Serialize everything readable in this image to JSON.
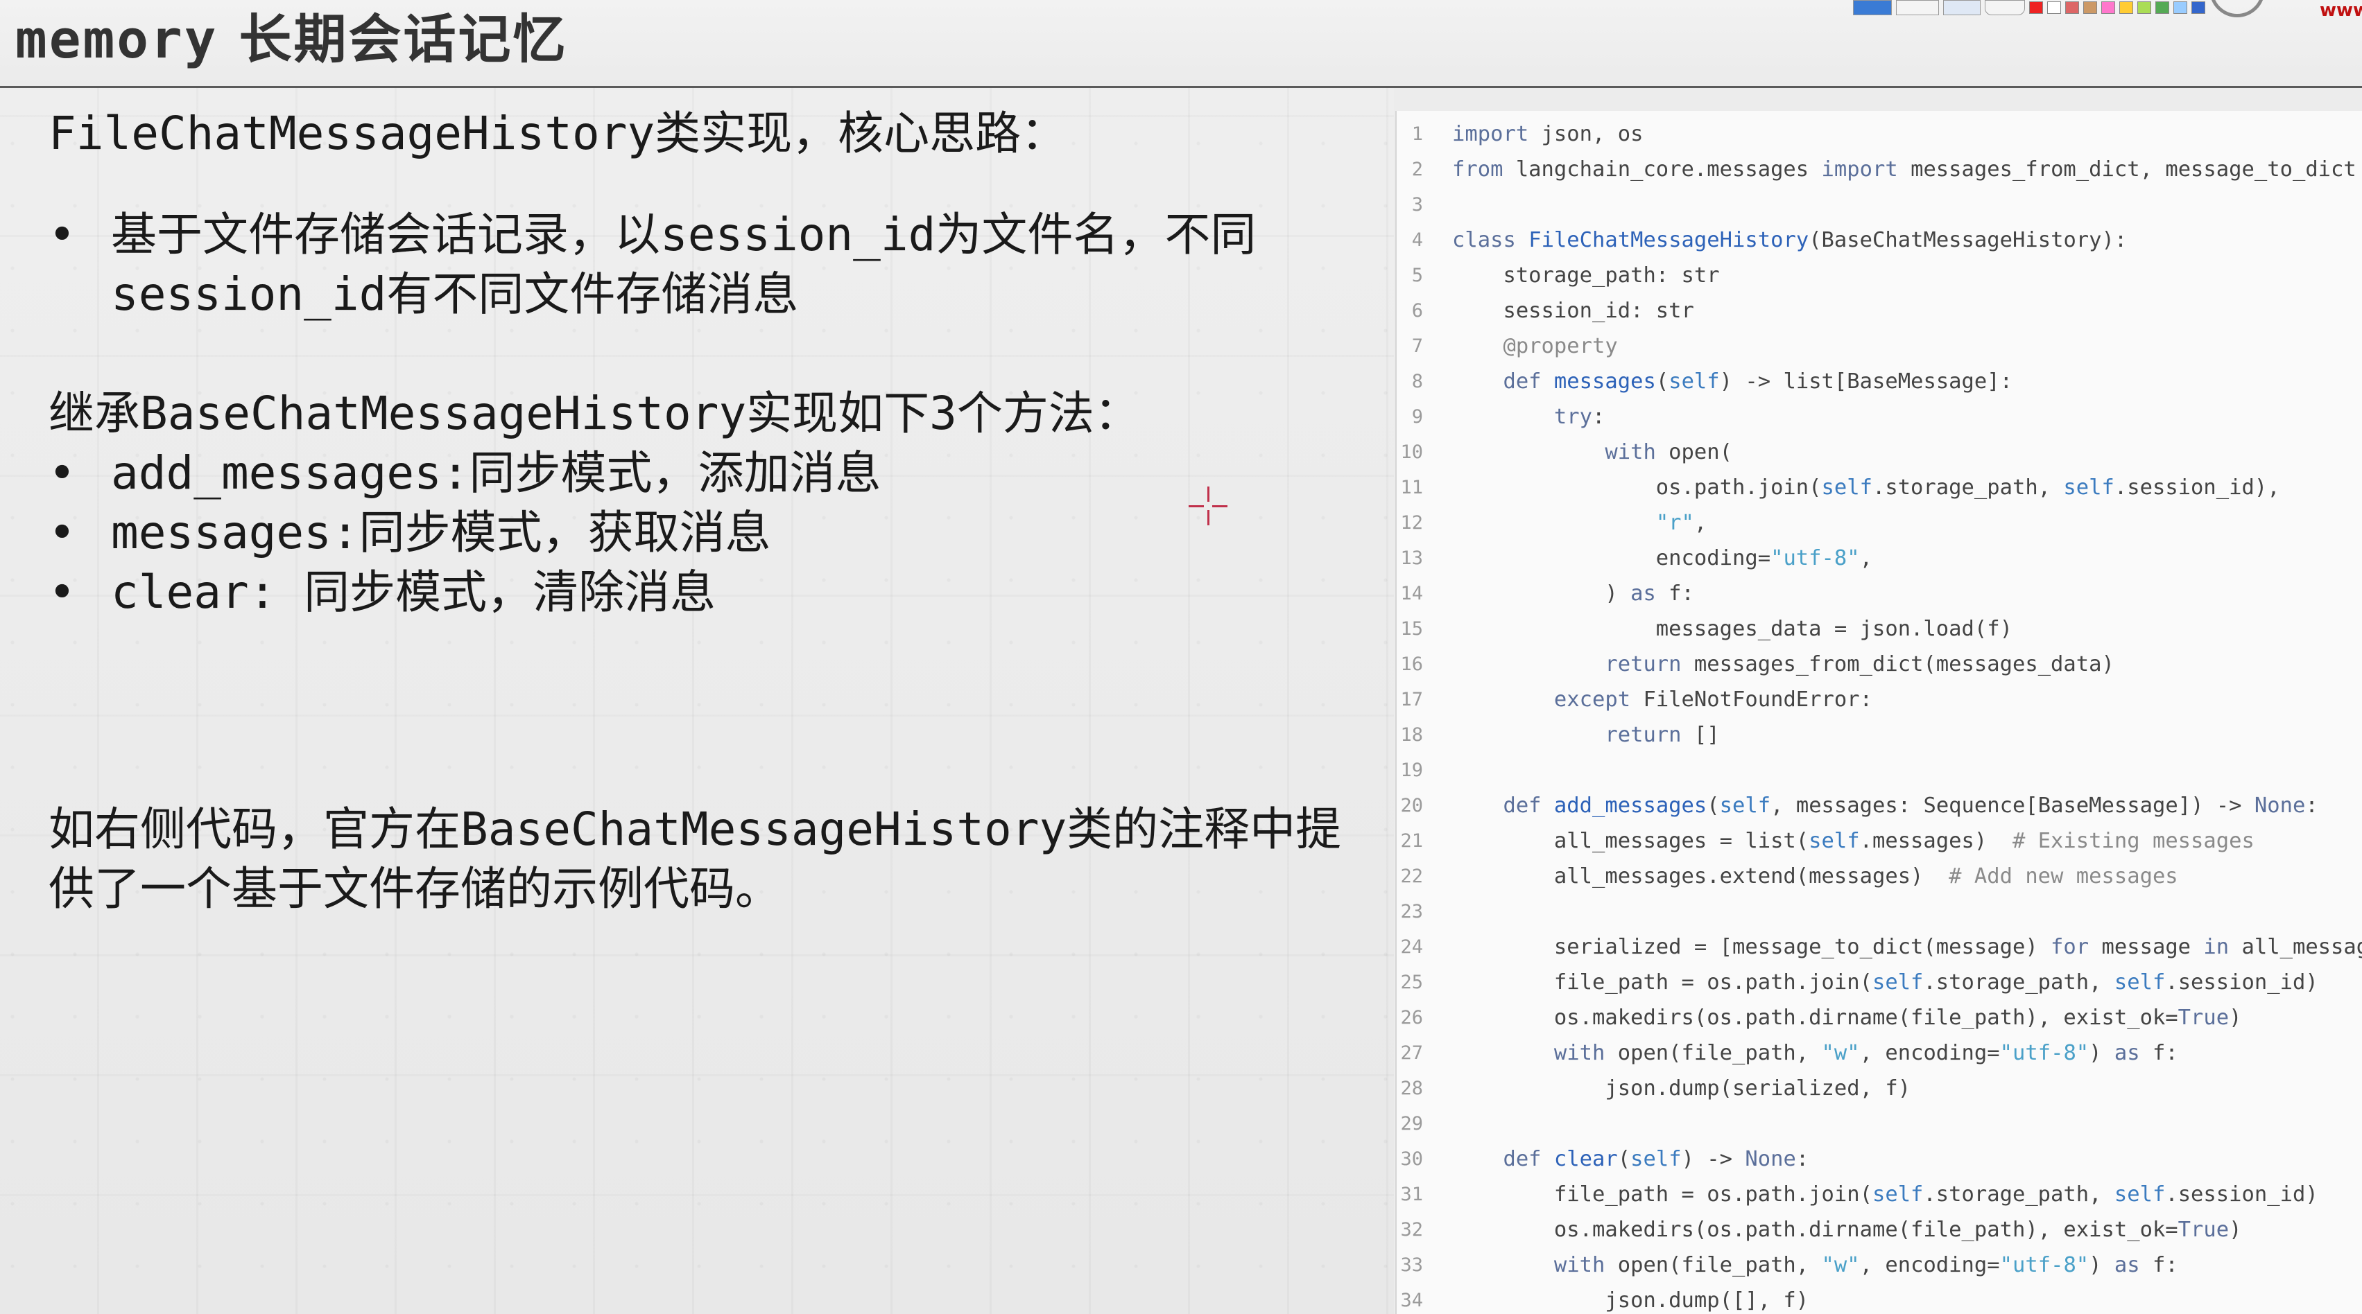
{
  "header": {
    "title_en": "memory",
    "title_cn": "长期会话记忆",
    "corner_text": "www"
  },
  "left": {
    "intro": "FileChatMessageHistory类实现，核心思路：",
    "bullets_a": [
      "基于文件存储会话记录，以session_id为文件名，不同session_id有不同文件存储消息"
    ],
    "inherit_heading": "继承BaseChatMessageHistory实现如下3个方法：",
    "bullets_b": [
      "add_messages:同步模式，添加消息",
      "messages:同步模式，获取消息",
      "clear: 同步模式，清除消息"
    ],
    "note": "如右侧代码，官方在BaseChatMessageHistory类的注释中提供了一个基于文件存储的示例代码。"
  },
  "code": {
    "lines": [
      {
        "n": "1",
        "t": "import json, os"
      },
      {
        "n": "2",
        "t": "from langchain_core.messages import messages_from_dict, message_to_dict"
      },
      {
        "n": "3",
        "t": ""
      },
      {
        "n": "4",
        "t": "class FileChatMessageHistory(BaseChatMessageHistory):"
      },
      {
        "n": "5",
        "t": "    storage_path: str"
      },
      {
        "n": "6",
        "t": "    session_id: str"
      },
      {
        "n": "7",
        "t": "    @property"
      },
      {
        "n": "8",
        "t": "    def messages(self) -> list[BaseMessage]:"
      },
      {
        "n": "9",
        "t": "        try:"
      },
      {
        "n": "10",
        "t": "            with open("
      },
      {
        "n": "11",
        "t": "                os.path.join(self.storage_path, self.session_id),"
      },
      {
        "n": "12",
        "t": "                \"r\","
      },
      {
        "n": "13",
        "t": "                encoding=\"utf-8\","
      },
      {
        "n": "14",
        "t": "            ) as f:"
      },
      {
        "n": "15",
        "t": "                messages_data = json.load(f)"
      },
      {
        "n": "16",
        "t": "            return messages_from_dict(messages_data)"
      },
      {
        "n": "17",
        "t": "        except FileNotFoundError:"
      },
      {
        "n": "18",
        "t": "            return []"
      },
      {
        "n": "19",
        "t": ""
      },
      {
        "n": "20",
        "t": "    def add_messages(self, messages: Sequence[BaseMessage]) -> None:"
      },
      {
        "n": "21",
        "t": "        all_messages = list(self.messages)  # Existing messages"
      },
      {
        "n": "22",
        "t": "        all_messages.extend(messages)  # Add new messages"
      },
      {
        "n": "23",
        "t": ""
      },
      {
        "n": "24",
        "t": "        serialized = [message_to_dict(message) for message in all_messag"
      },
      {
        "n": "25",
        "t": "        file_path = os.path.join(self.storage_path, self.session_id)"
      },
      {
        "n": "26",
        "t": "        os.makedirs(os.path.dirname(file_path), exist_ok=True)"
      },
      {
        "n": "27",
        "t": "        with open(file_path, \"w\", encoding=\"utf-8\") as f:"
      },
      {
        "n": "28",
        "t": "            json.dump(serialized, f)"
      },
      {
        "n": "29",
        "t": ""
      },
      {
        "n": "30",
        "t": "    def clear(self) -> None:"
      },
      {
        "n": "31",
        "t": "        file_path = os.path.join(self.storage_path, self.session_id)"
      },
      {
        "n": "32",
        "t": "        os.makedirs(os.path.dirname(file_path), exist_ok=True)"
      },
      {
        "n": "33",
        "t": "        with open(file_path, \"w\", encoding=\"utf-8\") as f:"
      },
      {
        "n": "34",
        "t": "            json.dump([], f)"
      }
    ]
  },
  "colors": {
    "accent_cursor": "#c0304a",
    "code_keyword": "#5b6f9a",
    "code_function": "#2d62b8",
    "code_string": "#4aa0c8"
  }
}
